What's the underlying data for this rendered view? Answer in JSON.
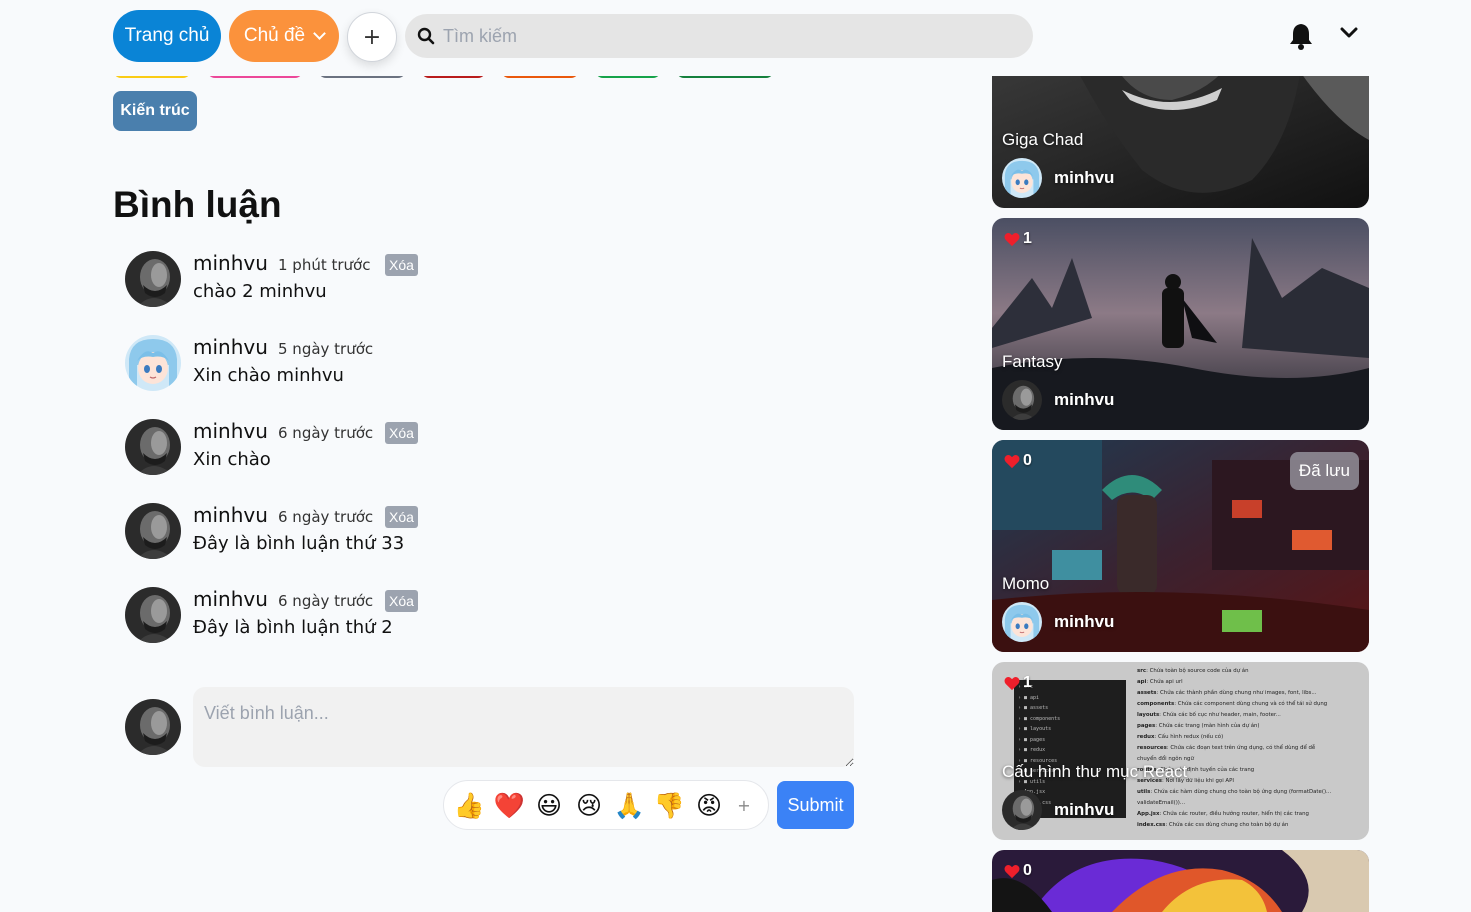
{
  "header": {
    "home_label": "Trang chủ",
    "topics_label": "Chủ đề",
    "add_label": "+",
    "search_placeholder": "Tìm kiếm",
    "bell_icon": "bell-icon",
    "menu_icon": "chevron-down-icon"
  },
  "tags": {
    "strip_colors": [
      "#facc15",
      "#ec4899",
      "#6b7280",
      "#b91c1c",
      "#ea580c",
      "#16a34a",
      "#15803d"
    ],
    "visible_tag": "Kiến trúc"
  },
  "comments": {
    "title": "Bình luận",
    "items": [
      {
        "author": "minhvu",
        "time": "1 phút trước",
        "delete_label": "Xóa",
        "text": "chào 2 minhvu",
        "avatar": "dark-avatar"
      },
      {
        "author": "minhvu",
        "time": "5 ngày trước",
        "delete_label": "",
        "text": "Xin chào minhvu",
        "avatar": "anime-avatar"
      },
      {
        "author": "minhvu",
        "time": "6 ngày trước",
        "delete_label": "Xóa",
        "text": "Xin chào",
        "avatar": "dark-avatar"
      },
      {
        "author": "minhvu",
        "time": "6 ngày trước",
        "delete_label": "Xóa",
        "text": "Đây là bình luận thứ 33",
        "avatar": "dark-avatar"
      },
      {
        "author": "minhvu",
        "time": "6 ngày trước",
        "delete_label": "Xóa",
        "text": "Đây là bình luận thứ 2",
        "avatar": "dark-avatar"
      }
    ],
    "compose_placeholder": "Viết bình luận...",
    "emojis": [
      "👍",
      "❤️",
      "😃",
      "😢",
      "🙏",
      "👎",
      "😡"
    ],
    "emoji_more": "+",
    "submit_label": "Submit"
  },
  "cards": [
    {
      "title": "Giga Chad",
      "author": "minhvu",
      "likes": "",
      "saved": ""
    },
    {
      "title": "Fantasy",
      "author": "minhvu",
      "likes": "1",
      "saved": ""
    },
    {
      "title": "Momo",
      "author": "minhvu",
      "likes": "0",
      "saved": "Đã lưu"
    },
    {
      "title": "Cấu hình thư mục React",
      "author": "minhvu",
      "likes": "1",
      "saved": ""
    },
    {
      "title": "",
      "author": "",
      "likes": "0",
      "saved": ""
    }
  ],
  "colors": {
    "home": "#0a84d6",
    "topics": "#fb923c",
    "tag": "#4a7fad",
    "submit": "#3b82f6",
    "delete": "#9ca3af",
    "heart": "#ef1f2b"
  }
}
